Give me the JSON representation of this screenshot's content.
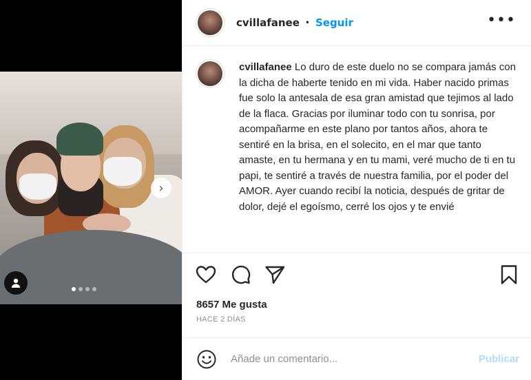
{
  "post": {
    "username": "cvillafanee",
    "follow_label": "Seguir",
    "separator": "•",
    "more_icon": "more-horizontal-icon",
    "caption_text": "Lo duro de este duelo no se compara jamás con la dicha de haberte tenido en mi vida. Haber nacido primas fue solo la antesala de esa gran amistad que tejimos al lado de la flaca. Gracias por iluminar todo con tu sonrisa, por acompañarme en este plano por tantos años, ahora te sentiré en la brisa, en el solecito, en el mar que tanto amaste, en tu hermana y en tu mami, veré mucho de ti en tu papi, te sentiré a través de nuestra familia, por el poder del AMOR. Ayer cuando recibí la noticia, después de gritar de dolor, dejé el egoísmo, cerré los ojos y te envié",
    "likes": "8657 Me gusta",
    "timestamp": "HACE 2 DÍAS"
  },
  "media": {
    "carousel_dots": 4,
    "active_dot": 0,
    "next_icon": "chevron-right-icon",
    "user_tag_icon": "user-icon"
  },
  "actions": {
    "like_icon": "heart-icon",
    "comment_icon": "comment-icon",
    "share_icon": "paper-plane-icon",
    "save_icon": "bookmark-icon"
  },
  "comment": {
    "placeholder": "Añade un comentario...",
    "publish_label": "Publicar",
    "emoji_icon": "smiley-icon"
  },
  "colors": {
    "link_blue": "#0095f6",
    "publish_disabled": "#b3dbff",
    "secondary_text": "#8e8e8e"
  }
}
